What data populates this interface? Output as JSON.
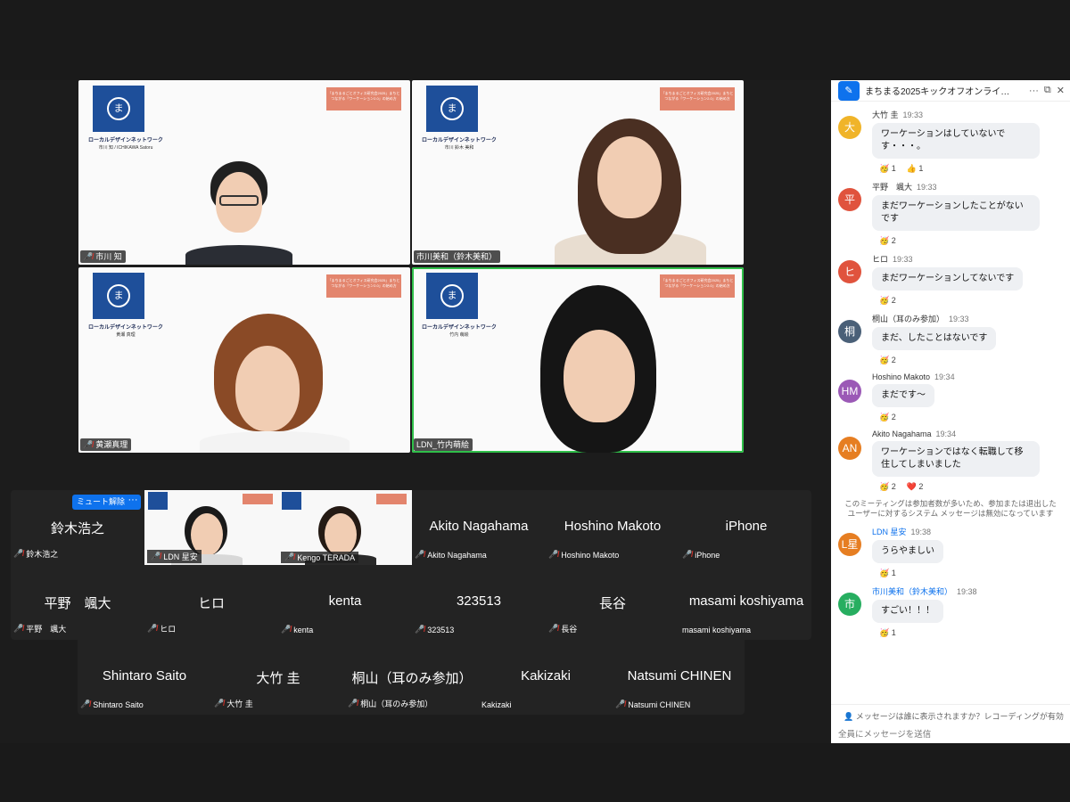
{
  "meeting": {
    "tiles": [
      {
        "name": "市川 知",
        "org": "ローカルデザインネットワーク",
        "sub": "市川 知 / ICHIKAWA Satoru"
      },
      {
        "name": "市川美和（鈴木美和）",
        "org": "ローカルデザインネットワーク",
        "sub": "市川 鈴木 美和"
      },
      {
        "name": "黄瀬真理",
        "org": "ローカルデザインネットワーク",
        "sub": "黄瀬 真理"
      },
      {
        "name": "LDN_竹内萌絵",
        "org": "ローカルデザインネットワーク",
        "sub": "竹内 萌絵"
      }
    ],
    "banner_text": "「まちまるごとオフィス研究会2025」まちとつながる「ワーケーション2.0」の始め方",
    "logo_char": "ま",
    "unmute_label": "ミュート解除",
    "more_label": "···",
    "gallery_row1": [
      {
        "big": "鈴木浩之",
        "small": "鈴木浩之",
        "muted": true
      },
      {
        "video": true,
        "small": "LDN 星安",
        "muted": true
      },
      {
        "video": true,
        "small": "Kengo TERADA",
        "muted": true
      },
      {
        "big": "Akito Nagahama",
        "small": "Akito Nagahama",
        "muted": true
      },
      {
        "big": "Hoshino Makoto",
        "small": "Hoshino Makoto",
        "muted": true
      },
      {
        "big": "iPhone",
        "small": "iPhone",
        "muted": true
      }
    ],
    "gallery_row2": [
      {
        "big": "平野　颯大",
        "small": "平野　颯大",
        "muted": true
      },
      {
        "big": "ヒロ",
        "small": "ヒロ",
        "muted": true
      },
      {
        "big": "kenta",
        "small": "kenta",
        "muted": true
      },
      {
        "big": "323513",
        "small": "323513",
        "muted": true
      },
      {
        "big": "長谷",
        "small": "長谷",
        "muted": true
      },
      {
        "big": "masami koshiyama",
        "small": "masami koshiyama",
        "muted": false
      }
    ],
    "gallery_row3": [
      {
        "big": "Shintaro Saito",
        "small": "Shintaro Saito",
        "muted": true
      },
      {
        "big": "大竹 圭",
        "small": "大竹 圭",
        "muted": true
      },
      {
        "big": "桐山（耳のみ参加）",
        "small": "桐山（耳のみ参加）",
        "muted": true
      },
      {
        "big": "Kakizaki",
        "small": "Kakizaki",
        "muted": false
      },
      {
        "big": "Natsumi CHINEN",
        "small": "Natsumi CHINEN",
        "muted": true
      }
    ]
  },
  "chat": {
    "title": "まちまる2025キックオフオンライ…",
    "header_more": "···",
    "popout_icon": "popout-icon",
    "close_icon": "close-icon",
    "messages": [
      {
        "avatar": "大",
        "color": "#f0b429",
        "name": "大竹 圭",
        "time": "19:33",
        "text": "ワーケーションはしていないです・・・。",
        "reactions": [
          "🥳 1",
          "👍 1"
        ]
      },
      {
        "avatar": "平",
        "color": "#e0533d",
        "name": "平野　颯大",
        "time": "19:33",
        "text": "まだワーケーションしたことがないです",
        "reactions": [
          "🥳 2"
        ]
      },
      {
        "avatar": "ヒ",
        "color": "#e0533d",
        "name": "ヒロ",
        "time": "19:33",
        "text": "まだワーケーションしてないです",
        "reactions": [
          "🥳 2"
        ]
      },
      {
        "avatar": "桐",
        "color": "#4a6078",
        "name": "桐山（耳のみ参加）",
        "time": "19:33",
        "text": "まだ、したことはないです",
        "reactions": [
          "🥳 2"
        ]
      },
      {
        "avatar": "HM",
        "color": "#9b59b6",
        "name": "Hoshino Makoto",
        "time": "19:34",
        "text": "まだです〜",
        "reactions": [
          "🥳 2"
        ]
      },
      {
        "avatar": "AN",
        "color": "#e67e22",
        "name": "Akito Nagahama",
        "time": "19:34",
        "text": "ワーケーションではなく転職して移住してしまいました",
        "reactions": [
          "🥳 2",
          "❤️ 2"
        ]
      }
    ],
    "system_message": "このミーティングは参加者数が多いため、参加または退出したユーザーに対するシステム メッセージは無効になっています",
    "messages2": [
      {
        "avatar": "L星",
        "color": "#e67e22",
        "name": "LDN 星安",
        "time": "19:38",
        "text": "うらやましい",
        "reactions": [
          "🥳 1"
        ],
        "blue": true
      },
      {
        "avatar": "市",
        "color": "#27ae60",
        "name": "市川美和（鈴木美和）",
        "time": "19:38",
        "text": "すごい！！！",
        "reactions": [
          "🥳 1"
        ],
        "blue": true
      }
    ],
    "notice": "メッセージは誰に表示されますか？レコーディングが有効",
    "input_placeholder": "全員にメッセージを送信"
  }
}
